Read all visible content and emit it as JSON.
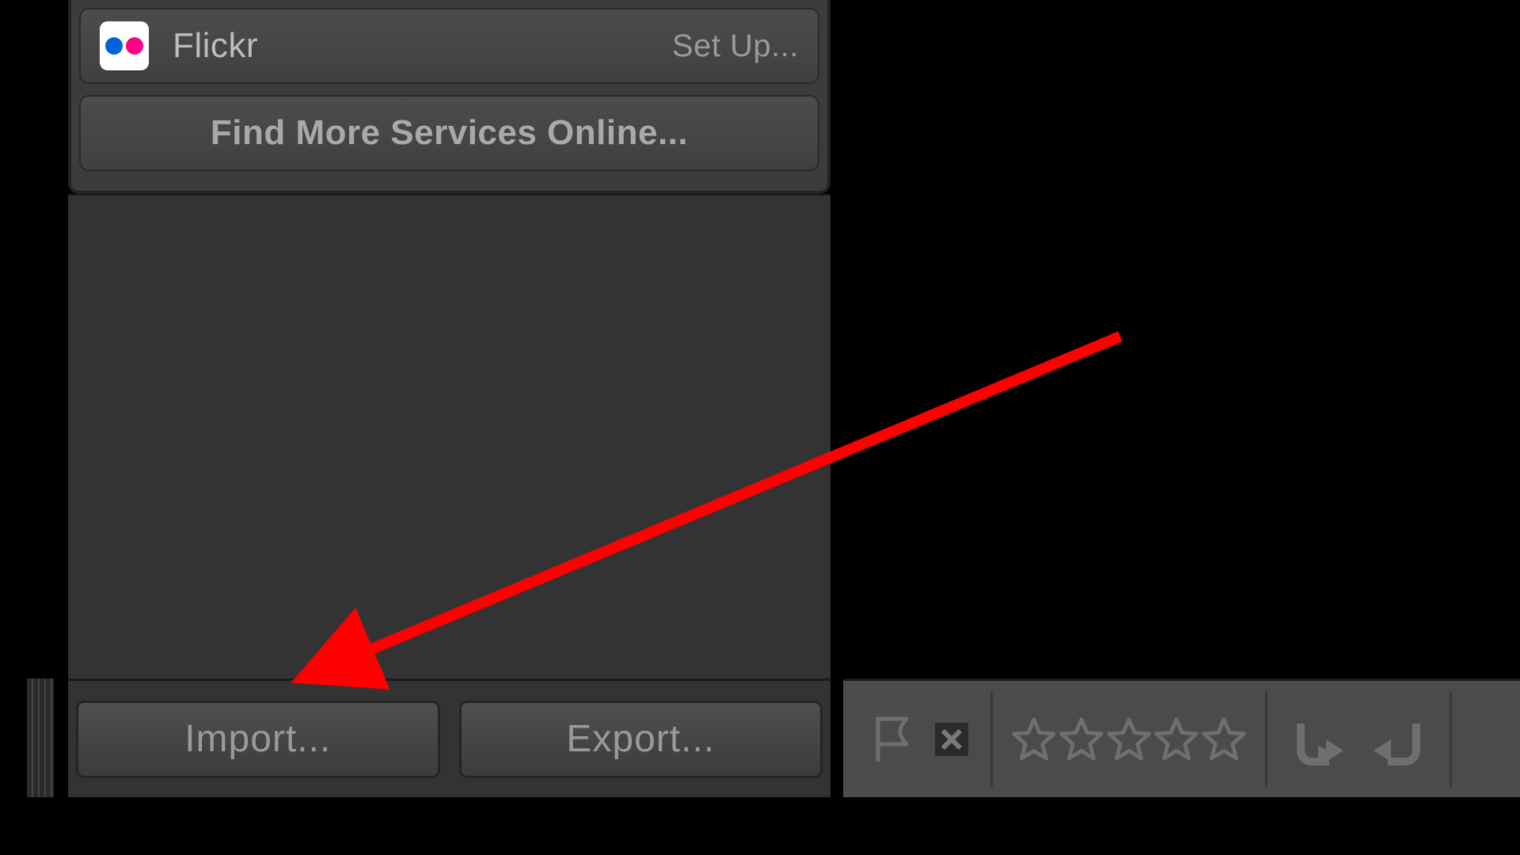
{
  "publish_services": {
    "flickr": {
      "name": "Flickr",
      "action": "Set Up..."
    },
    "find_more": "Find More Services Online..."
  },
  "buttons": {
    "import": "Import...",
    "export": "Export..."
  },
  "toolbar": {
    "rating_max": 5
  },
  "annotation": {
    "color": "#ff0000"
  }
}
